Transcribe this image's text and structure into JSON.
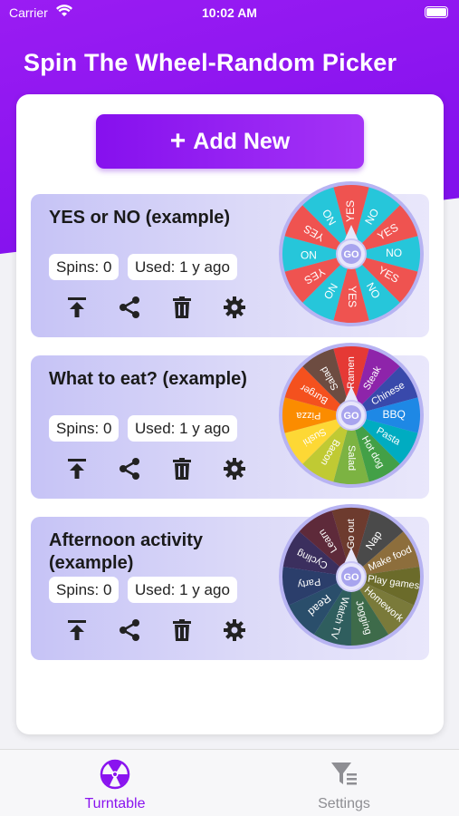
{
  "status_bar": {
    "carrier": "Carrier",
    "time": "10:02 AM"
  },
  "header": {
    "title": "Spin The Wheel-Random Picker"
  },
  "add_button": {
    "label": "Add New"
  },
  "wheels": [
    {
      "name": "YES or NO (example)",
      "spins": "Spins: 0",
      "used": "Used: 1 y ago",
      "center": "GO",
      "segments": [
        "YES",
        "NO",
        "YES",
        "NO",
        "YES",
        "NO",
        "YES",
        "NO",
        "YES",
        "NO",
        "YES",
        "NO"
      ],
      "colors": [
        "#ef5350",
        "#26c6da"
      ]
    },
    {
      "name": "What to eat? (example)",
      "spins": "Spins: 0",
      "used": "Used: 1 y ago",
      "center": "GO",
      "segments": [
        "Ramen",
        "Steak",
        "Chinese",
        "BBQ",
        "Pasta",
        "Hot dog",
        "Salad",
        "Bacon",
        "Sushi",
        "Pizza",
        "Burger",
        "Salad"
      ],
      "colors": [
        "#e53935",
        "#8e24aa",
        "#3949ab",
        "#1e88e5",
        "#00acc1",
        "#43a047",
        "#7cb342",
        "#c0ca33",
        "#fdd835",
        "#fb8c00",
        "#f4511e",
        "#6d4c41"
      ]
    },
    {
      "name": "Afternoon activity (example)",
      "spins": "Spins: 0",
      "used": "Used: 1 y ago",
      "center": "GO",
      "segments": [
        "Go out",
        "Nap",
        "Make food",
        "Play games",
        "Homework",
        "Jogging",
        "Watch TV",
        "Read",
        "Party",
        "Cycling",
        "Learn"
      ],
      "colors": [
        "#6d3b2e",
        "#4a4a4a",
        "#8d6e3c",
        "#6b6b2a",
        "#7a7a3a",
        "#3e6b4a",
        "#2f5e5e",
        "#2a4e6b",
        "#2b3e6b",
        "#3b2f5e",
        "#5e2a3a"
      ]
    }
  ],
  "tabbar": {
    "items": [
      {
        "label": "Turntable",
        "icon": "radiation-icon",
        "color": "#8a14ef",
        "active": true
      },
      {
        "label": "Settings",
        "icon": "filter-settings-icon",
        "color": "#8e8e93",
        "active": false
      }
    ]
  },
  "colors": {
    "accent": "#8a14ef",
    "card_bg": "#ffffff"
  }
}
